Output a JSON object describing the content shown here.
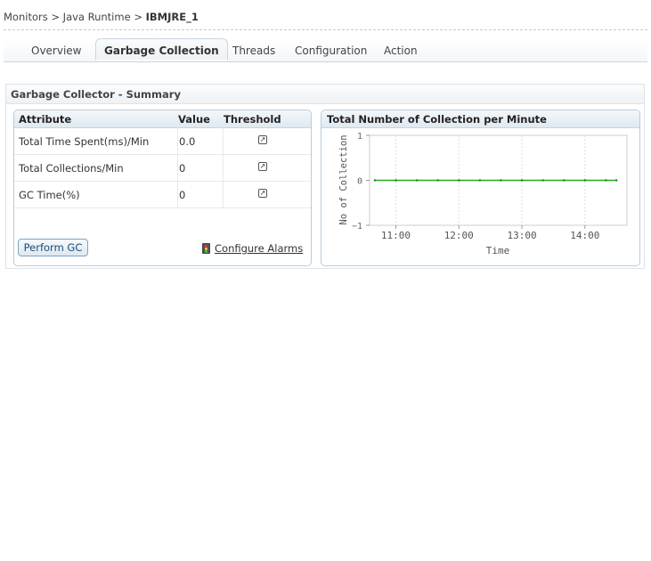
{
  "breadcrumb": {
    "part1": "Monitors",
    "sep": ">",
    "part2": "Java Runtime",
    "current": "IBMJRE_1"
  },
  "tabs": [
    {
      "label": "Overview"
    },
    {
      "label": "Garbage Collection"
    },
    {
      "label": "Threads"
    },
    {
      "label": "Configuration"
    },
    {
      "label": "Action"
    }
  ],
  "summary": {
    "title": "Garbage Collector - Summary",
    "table": {
      "headers": [
        "Attribute",
        "Value",
        "Threshold"
      ],
      "rows": [
        {
          "attribute": "Total Time Spent(ms)/Min",
          "value": "0.0"
        },
        {
          "attribute": "Total Collections/Min",
          "value": "0"
        },
        {
          "attribute": "GC Time(%)",
          "value": "0"
        }
      ]
    },
    "perform_gc": "Perform GC",
    "configure_alarms": "Configure Alarms"
  },
  "colors": {
    "line": "#22aa22",
    "panel_border": "#b8cddd"
  },
  "chart_data": {
    "type": "line",
    "title": "Total Number of Collection per Minute",
    "xlabel": "Time",
    "ylabel": "No of Collection",
    "ylim": [
      -1,
      1
    ],
    "yticks": [
      "1",
      "0",
      "−1"
    ],
    "xticks": [
      "11:00",
      "12:00",
      "13:00",
      "14:00"
    ],
    "grid": true,
    "series": [
      {
        "x": [
          "10:40",
          "11:00",
          "11:20",
          "11:40",
          "12:00",
          "12:20",
          "12:40",
          "13:00",
          "13:20",
          "13:40",
          "14:00",
          "14:20",
          "14:30"
        ],
        "values": [
          0,
          0,
          0,
          0,
          0,
          0,
          0,
          0,
          0,
          0,
          0,
          0,
          0
        ]
      }
    ]
  }
}
